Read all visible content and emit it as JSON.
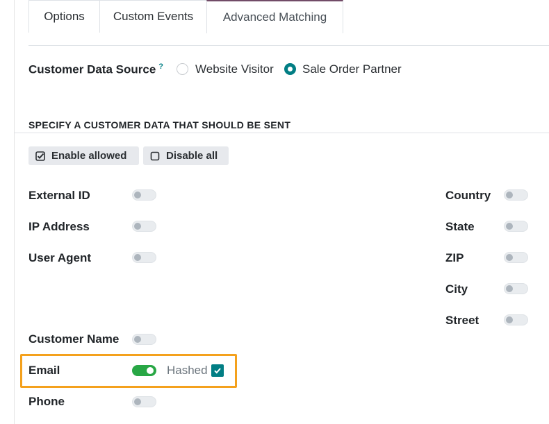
{
  "tabs": [
    {
      "label": "Options"
    },
    {
      "label": "Custom Events"
    },
    {
      "label": "Advanced Matching"
    }
  ],
  "data_source": {
    "label": "Customer Data Source",
    "help_mark": "?",
    "options": [
      {
        "label": "Website Visitor",
        "selected": false
      },
      {
        "label": "Sale Order Partner",
        "selected": true
      }
    ]
  },
  "section_title": "SPECIFY A CUSTOMER DATA THAT SHOULD BE SENT",
  "buttons": {
    "enable_allowed": "Enable allowed",
    "disable_all": "Disable all"
  },
  "fields_left": [
    {
      "label": "External ID",
      "enabled": false
    },
    {
      "label": "IP Address",
      "enabled": false
    },
    {
      "label": "User Agent",
      "enabled": false
    },
    {
      "label": "Customer Name",
      "enabled": false
    },
    {
      "label": "Email",
      "enabled": true,
      "hashed_label": "Hashed",
      "hashed": true
    },
    {
      "label": "Phone",
      "enabled": false
    }
  ],
  "fields_right": [
    {
      "label": "Country",
      "enabled": false
    },
    {
      "label": "State",
      "enabled": false
    },
    {
      "label": "ZIP",
      "enabled": false
    },
    {
      "label": "City",
      "enabled": false
    },
    {
      "label": "Street",
      "enabled": false
    }
  ],
  "colors": {
    "accent": "#017e84",
    "tab_active_border": "#714b67",
    "toggle_on": "#28a745",
    "highlight": "#f4a11d"
  }
}
